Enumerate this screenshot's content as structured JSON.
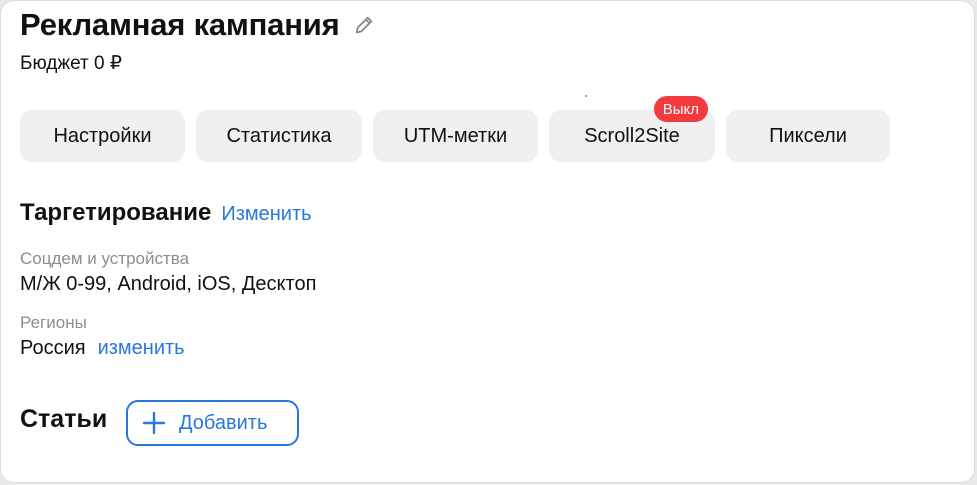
{
  "header": {
    "title": "Рекламная кампания",
    "edit_icon": "pencil-icon",
    "budget": "Бюджет 0 ₽"
  },
  "tabs": [
    {
      "label": "Настройки"
    },
    {
      "label": "Статистика"
    },
    {
      "label": "UTM-метки"
    },
    {
      "label": "Scroll2Site",
      "badge": "Выкл"
    },
    {
      "label": "Пиксели"
    }
  ],
  "targeting": {
    "title": "Таргетирование",
    "change_link": "Изменить",
    "audience_label": "Соцдем и устройства",
    "audience_value": "М/Ж 0-99, Android, iOS, Десктоп",
    "regions_label": "Регионы",
    "regions_value": "Россия",
    "regions_change_link": "изменить"
  },
  "articles": {
    "title": "Статьи",
    "add_button_label": "Добавить",
    "add_icon": "plus-icon"
  },
  "colors": {
    "accent": "#2a77db",
    "badge": "#f33a3f",
    "tab_bg": "#f0f0f2"
  }
}
